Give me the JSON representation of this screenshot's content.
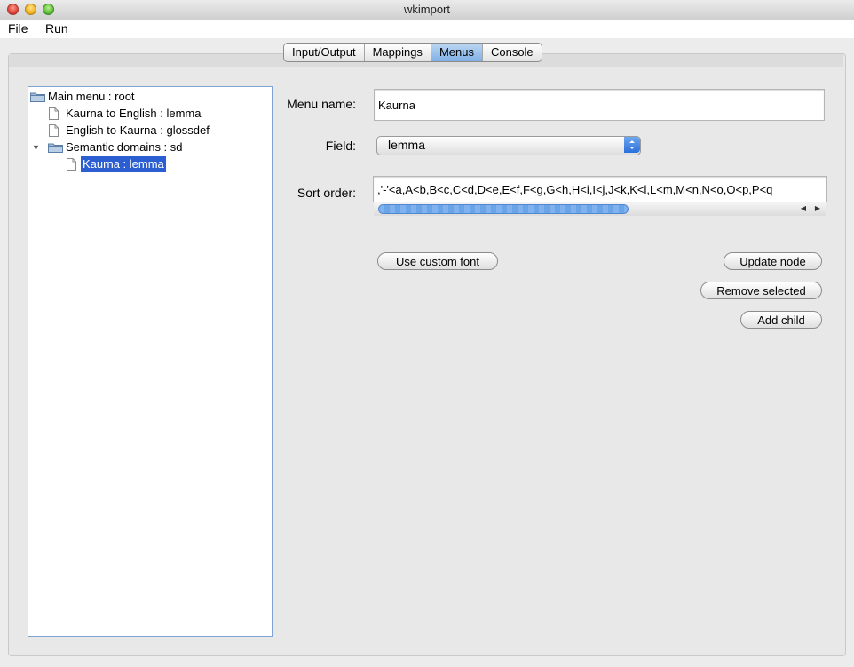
{
  "window": {
    "title": "wkimport"
  },
  "menubar": {
    "items": [
      "File",
      "Run"
    ]
  },
  "tabs": {
    "items": [
      "Input/Output",
      "Mappings",
      "Menus",
      "Console"
    ],
    "active": "Menus"
  },
  "tree": {
    "nodes": [
      {
        "label": "Main menu : root",
        "icon": "folder-icon"
      },
      {
        "label": "Kaurna to English : lemma",
        "icon": "document-icon"
      },
      {
        "label": "English to Kaurna : glossdef",
        "icon": "document-icon"
      },
      {
        "label": "Semantic domains : sd",
        "icon": "folder-icon",
        "expanded": true
      },
      {
        "label": "Kaurna : lemma",
        "icon": "document-icon",
        "selected": true
      }
    ]
  },
  "form": {
    "menu_name_label": "Menu name:",
    "menu_name_value": "Kaurna",
    "field_label": "Field:",
    "field_value": "lemma",
    "sort_order_label": "Sort order:",
    "sort_order_value": ",'-'<a,A<b,B<c,C<d,D<e,E<f,F<g,G<h,H<i,I<j,J<k,K<l,L<m,M<n,N<o,O<p,P<q",
    "sort_scroll_fraction": 0.6
  },
  "buttons": {
    "use_custom_font": "Use custom font",
    "update_node": "Update node",
    "remove_selected": "Remove selected",
    "add_child": "Add child"
  },
  "colors": {
    "selection": "#2b5fd1",
    "active_tab": "#7fb0e6"
  }
}
